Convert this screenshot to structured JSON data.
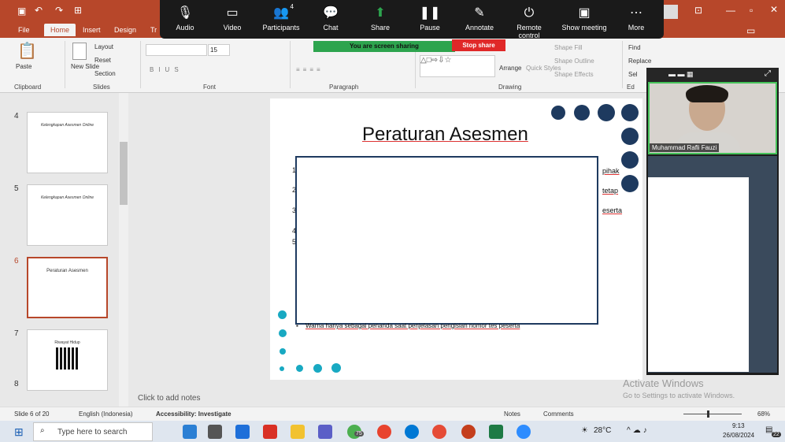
{
  "ribbon_tabs": [
    "File",
    "Home",
    "Insert",
    "Design",
    "Tr"
  ],
  "zoom_toolbar": [
    {
      "label": "Audio",
      "icon": "microphone-icon"
    },
    {
      "label": "Video",
      "icon": "camera-icon"
    },
    {
      "label": "Participants",
      "icon": "participants-icon",
      "badge": "4"
    },
    {
      "label": "Chat",
      "icon": "chat-icon"
    },
    {
      "label": "Share",
      "icon": "share-icon"
    },
    {
      "label": "Pause",
      "icon": "pause-icon"
    },
    {
      "label": "Annotate",
      "icon": "pen-icon"
    },
    {
      "label": "Remote control",
      "icon": "remote-icon"
    },
    {
      "label": "Show meeting",
      "icon": "window-icon"
    },
    {
      "label": "More",
      "icon": "more-icon"
    }
  ],
  "sharing_banner": "You are screen sharing",
  "stop_share": "Stop share",
  "ribbon": {
    "clipboard": "Clipboard",
    "paste": "Paste",
    "slides": "Slides",
    "new_slide": "New Slide",
    "layout": "Layout",
    "reset": "Reset",
    "section": "Section",
    "font": "Font",
    "font_size": "15",
    "paragraph": "Paragraph",
    "drawing": "Drawing",
    "arrange": "Arrange",
    "quick_styles": "Quick Styles",
    "shape_fill": "Shape Fill",
    "shape_outline": "Shape Outline",
    "shape_effects": "Shape Effects",
    "find": "Find",
    "replace": "Replace",
    "select": "Sel",
    "editing": "Ed"
  },
  "thumbnails": [
    {
      "num": "4",
      "title": "Kelengkapan Asesmen Online"
    },
    {
      "num": "5",
      "title": "Kelengkapan Asesmen Online"
    },
    {
      "num": "6",
      "title": "Peraturan Asesmen"
    },
    {
      "num": "7",
      "title": "Riwayat Hidup"
    },
    {
      "num": "8",
      "title": ""
    }
  ],
  "slide": {
    "title": "Peraturan Asesmen",
    "fragments": [
      "pihak",
      "tetap",
      "eserta"
    ],
    "bullet": "Warna hanya sebagai penanda saat penjelasan pengisian nomor tes peserta",
    "numbers": [
      "1",
      "2",
      "3",
      "4",
      "5"
    ]
  },
  "notes_placeholder": "Click to add notes",
  "video": {
    "participant_name": "Muhammad Rafli Fauzi"
  },
  "watermark": {
    "line1": "Activate Windows",
    "line2": "Go to Settings to activate Windows."
  },
  "status": {
    "slide_info": "Slide 6 of 20",
    "language": "English (Indonesia)",
    "accessibility": "Accessibility: Investigate",
    "notes": "Notes",
    "comments": "Comments",
    "zoom": "68%"
  },
  "taskbar": {
    "search_placeholder": "Type here to search",
    "weather": "28°C",
    "time": "9:13",
    "date": "26/08/2024",
    "notif_badge": "22",
    "chrome_badge": "75"
  },
  "colors": {
    "ppt_accent": "#b7472a",
    "slide_navy": "#1e3a5f",
    "slide_teal": "#18a9c2",
    "zoom_green": "#2da44e",
    "stop_red": "#e02828"
  }
}
